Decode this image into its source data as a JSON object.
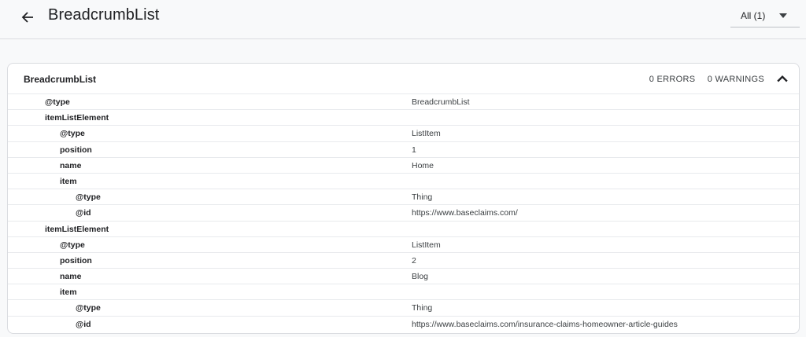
{
  "header": {
    "title": "BreadcrumbList",
    "filter_label": "All (1)"
  },
  "card": {
    "title": "BreadcrumbList",
    "errors": "0 ERRORS",
    "warnings": "0 WARNINGS"
  },
  "rows": [
    {
      "key": "@type",
      "value": "BreadcrumbList",
      "depth": 0
    },
    {
      "key": "itemListElement",
      "value": "",
      "depth": 0
    },
    {
      "key": "@type",
      "value": "ListItem",
      "depth": 1
    },
    {
      "key": "position",
      "value": "1",
      "depth": 1
    },
    {
      "key": "name",
      "value": "Home",
      "depth": 1
    },
    {
      "key": "item",
      "value": "",
      "depth": 1
    },
    {
      "key": "@type",
      "value": "Thing",
      "depth": 2
    },
    {
      "key": "@id",
      "value": "https://www.baseclaims.com/",
      "depth": 2
    },
    {
      "key": "itemListElement",
      "value": "",
      "depth": 0
    },
    {
      "key": "@type",
      "value": "ListItem",
      "depth": 1
    },
    {
      "key": "position",
      "value": "2",
      "depth": 1
    },
    {
      "key": "name",
      "value": "Blog",
      "depth": 1
    },
    {
      "key": "item",
      "value": "",
      "depth": 1
    },
    {
      "key": "@type",
      "value": "Thing",
      "depth": 2
    },
    {
      "key": "@id",
      "value": "https://www.baseclaims.com/insurance-claims-homeowner-article-guides",
      "depth": 2
    }
  ],
  "icons": {
    "back": "arrow-back-icon",
    "filter_caret": "caret-down-icon",
    "collapse": "chevron-up-icon"
  }
}
